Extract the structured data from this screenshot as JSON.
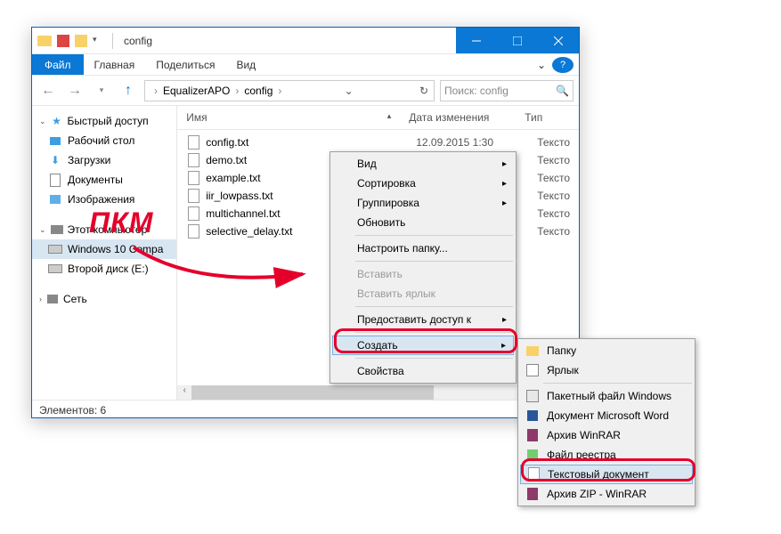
{
  "window": {
    "title": "config"
  },
  "ribbon": {
    "file": "Файл",
    "home": "Главная",
    "share": "Поделиться",
    "view": "Вид"
  },
  "address": {
    "crumb1": "EqualizerAPO",
    "crumb2": "config"
  },
  "search": {
    "placeholder": "Поиск: config"
  },
  "nav": {
    "quick": "Быстрый доступ",
    "desktop": "Рабочий стол",
    "downloads": "Загрузки",
    "documents": "Документы",
    "images": "Изображения",
    "thispc": "Этот компьютер",
    "win10": "Windows 10 Compa",
    "drive2": "Второй диск (E:)",
    "network": "Сеть"
  },
  "columns": {
    "name": "Имя",
    "modified": "Дата изменения",
    "type": "Тип"
  },
  "files": [
    {
      "name": "config.txt",
      "date": "12.09.2015 1:30",
      "type": "Тексто"
    },
    {
      "name": "demo.txt",
      "date": "",
      "type": "Тексто"
    },
    {
      "name": "example.txt",
      "date": "",
      "type": "Тексто"
    },
    {
      "name": "iir_lowpass.txt",
      "date": "",
      "type": "Тексто"
    },
    {
      "name": "multichannel.txt",
      "date": "",
      "type": "Тексто"
    },
    {
      "name": "selective_delay.txt",
      "date": "",
      "type": "Тексто"
    }
  ],
  "status": {
    "count": "Элементов: 6"
  },
  "ctx": {
    "view": "Вид",
    "sort": "Сортировка",
    "group": "Группировка",
    "refresh": "Обновить",
    "customize": "Настроить папку...",
    "paste": "Вставить",
    "paste_shortcut": "Вставить ярлык",
    "give_access": "Предоставить доступ к",
    "create": "Создать",
    "properties": "Свойства"
  },
  "submenu": {
    "folder": "Папку",
    "shortcut": "Ярлык",
    "batch": "Пакетный файл Windows",
    "word": "Документ Microsoft Word",
    "winrar": "Архив WinRAR",
    "reg": "Файл реестра",
    "text": "Текстовый документ",
    "zip": "Архив ZIP - WinRAR"
  },
  "annotation": {
    "pkm": "ПКМ"
  }
}
